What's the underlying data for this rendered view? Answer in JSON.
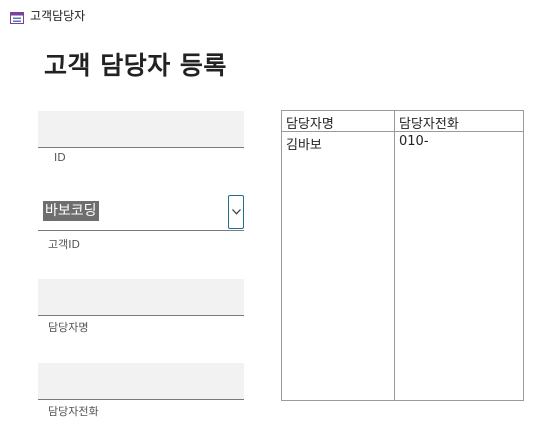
{
  "window": {
    "title": "고객담당자",
    "icon": "form-icon"
  },
  "form": {
    "heading": "고객 담당자 등록",
    "fields": {
      "id": {
        "label": "ID",
        "value": ""
      },
      "customer_id": {
        "label": "고객ID",
        "value": "바보코딩"
      },
      "manager_name": {
        "label": "담당자명",
        "value": ""
      },
      "manager_phone": {
        "label": "담당자전화",
        "value": ""
      }
    }
  },
  "subform": {
    "columns": [
      "담당자명",
      "담당자전화"
    ],
    "rows": [
      [
        "김바보",
        "010-"
      ]
    ]
  }
}
